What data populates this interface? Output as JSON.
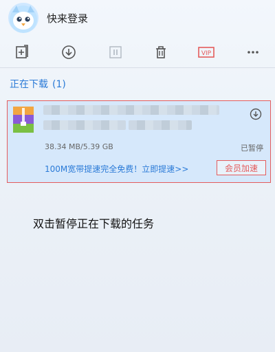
{
  "header": {
    "login_label": "快来登录"
  },
  "toolbar": {
    "new_task_icon": "add-file-icon",
    "download_icon": "download-icon",
    "pause_icon": "pause-icon",
    "delete_icon": "trash-icon",
    "vip_label": "VIP",
    "more_icon": "more-icon"
  },
  "section": {
    "title": "正在下载",
    "count": "(1)"
  },
  "item": {
    "size_text": "38.34 MB/5.39 GB",
    "status": "已暂停",
    "promo": "100M宽带提速完全免费！立即提速>>",
    "vip_button": "会员加速"
  },
  "instruction": "双击暂停正在下载的任务",
  "colors": {
    "accent_blue": "#2a7ad7",
    "alert_red": "#e45b5b",
    "selection_bg": "#d6e8fb"
  }
}
